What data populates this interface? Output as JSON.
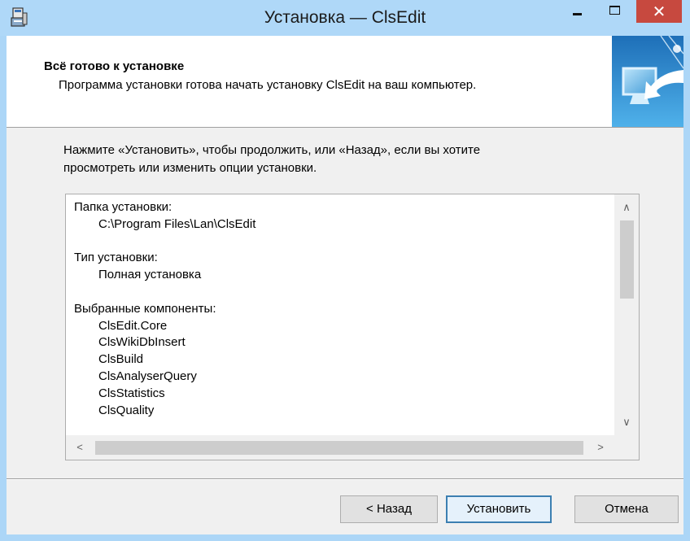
{
  "window": {
    "title": "Установка — ClsEdit",
    "close_glyph": "✕"
  },
  "header": {
    "title": "Всё готово к установке",
    "subtitle": "Программа установки готова начать установку ClsEdit на ваш компьютер."
  },
  "instruction": "Нажмите «Установить», чтобы продолжить, или «Назад», если вы хотите\nпросмотреть или изменить опции установки.",
  "memo": {
    "lines": [
      {
        "text": "Папка установки:",
        "indent": false
      },
      {
        "text": "C:\\Program Files\\Lan\\ClsEdit",
        "indent": true
      },
      {
        "text": "",
        "indent": false
      },
      {
        "text": "Тип установки:",
        "indent": false
      },
      {
        "text": "Полная установка",
        "indent": true
      },
      {
        "text": "",
        "indent": false
      },
      {
        "text": "Выбранные компоненты:",
        "indent": false
      },
      {
        "text": "ClsEdit.Core",
        "indent": true
      },
      {
        "text": "ClsWikiDbInsert",
        "indent": true
      },
      {
        "text": "ClsBuild",
        "indent": true
      },
      {
        "text": "ClsAnalyserQuery",
        "indent": true
      },
      {
        "text": "ClsStatistics",
        "indent": true
      },
      {
        "text": "ClsQuality",
        "indent": true
      }
    ]
  },
  "buttons": {
    "back": "< Назад",
    "install": "Установить",
    "cancel": "Отмена"
  },
  "icons": {
    "app": "installer-icon",
    "header": "computer-arrow-icon"
  },
  "colors": {
    "titlebar": "#afd8f8",
    "close": "#c7493f",
    "default_button_border": "#3c7fb1"
  }
}
